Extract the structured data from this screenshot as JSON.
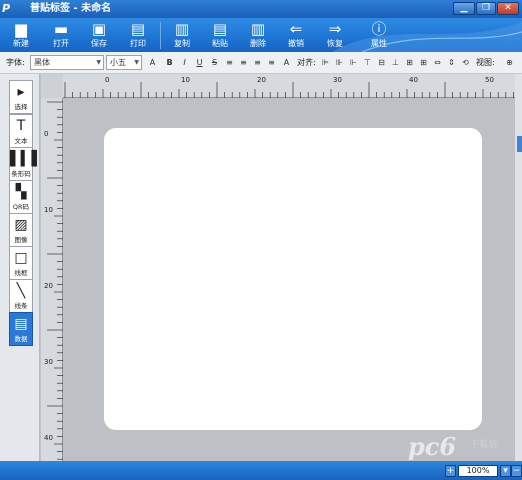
{
  "window": {
    "logo": "P",
    "title": "普贴标签 - 未命名",
    "minimize": "▁",
    "restore": "❐",
    "close": "✕"
  },
  "ribbon": {
    "buttons": [
      {
        "label": "新建",
        "icon": "new-icon",
        "glyph": "▆"
      },
      {
        "label": "打开",
        "icon": "open-folder-icon",
        "glyph": "▬"
      },
      {
        "label": "保存",
        "icon": "save-icon",
        "glyph": "▣"
      },
      {
        "label": "打印",
        "icon": "print-icon",
        "glyph": "▤"
      },
      {
        "label": "复制",
        "icon": "copy-icon",
        "glyph": "▥"
      },
      {
        "label": "粘贴",
        "icon": "paste-icon",
        "glyph": "▤"
      },
      {
        "label": "删除",
        "icon": "trash-icon",
        "glyph": "▥"
      },
      {
        "label": "撤销",
        "icon": "undo-arrow-icon",
        "glyph": "⇐"
      },
      {
        "label": "恢复",
        "icon": "redo-arrow-icon",
        "glyph": "⇒"
      },
      {
        "label": "属性",
        "icon": "info-icon",
        "glyph": "ⓘ"
      }
    ]
  },
  "format": {
    "font_label": "字体:",
    "font_value": "黑体",
    "size_value": "小五",
    "grow_font": "A",
    "bold": "B",
    "italic": "I",
    "underline": "U",
    "strike": "S",
    "align_label": "对齐:",
    "view_label": "视图:"
  },
  "tools": [
    {
      "label": "选择",
      "icon": "select-cursor-icon",
      "glyph": "▸"
    },
    {
      "label": "文本",
      "icon": "text-icon",
      "glyph": "T"
    },
    {
      "label": "条形码",
      "icon": "barcode-icon",
      "glyph": "▌▍▌"
    },
    {
      "label": "QR码",
      "icon": "qr-code-icon",
      "glyph": "▚"
    },
    {
      "label": "图像",
      "icon": "image-icon",
      "glyph": "▨"
    },
    {
      "label": "线框",
      "icon": "rectangle-icon",
      "glyph": "□"
    },
    {
      "label": "线条",
      "icon": "line-icon",
      "glyph": "╲"
    },
    {
      "label": "数据",
      "icon": "database-icon",
      "glyph": "▤"
    }
  ],
  "ruler": {
    "h_marks": [
      "0",
      "10",
      "20",
      "30",
      "40",
      "50"
    ],
    "v_marks": [
      "0",
      "10",
      "20",
      "30",
      "40"
    ]
  },
  "status": {
    "zoom": "100%",
    "zoom_in": "+",
    "zoom_out": "−",
    "watermark": "pc6",
    "watermark_site": "下载站"
  },
  "colors": {
    "ribbon_blue": "#1f74d2",
    "active_tool": "#2a78d8",
    "canvas_gray": "#bdc1c6"
  }
}
